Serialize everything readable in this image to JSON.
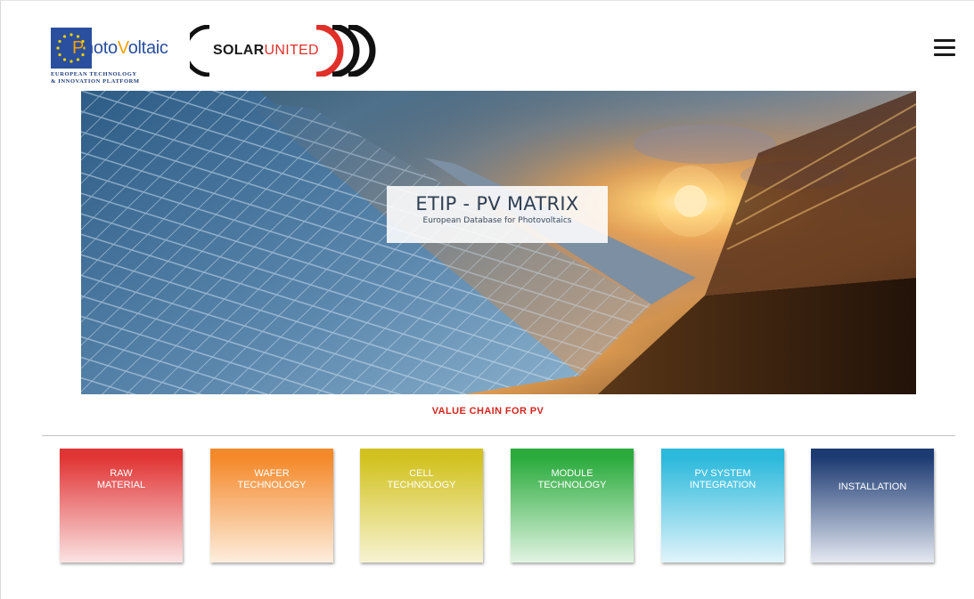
{
  "header": {
    "logo_pv": {
      "word_part1": "P",
      "word_part2": "hoto",
      "word_part3": "V",
      "word_part4": "oltaic",
      "line1": "EUROPEAN TECHNOLOGY",
      "line2": "& INNOVATION PLATFORM"
    },
    "logo_su": {
      "part1": "SOLAR",
      "part2": "UNITED"
    },
    "menu_icon": "hamburger-menu-icon"
  },
  "hero": {
    "title": "ETIP - PV MATRIX",
    "subtitle": "European Database for Photovoltaics"
  },
  "value_chain": {
    "title": "VALUE CHAIN FOR PV",
    "items": [
      {
        "label": "RAW\nMATERIAL",
        "color_top": "#e13535",
        "color_bottom": "#fbe3e3"
      },
      {
        "label": "WAFER\nTECHNOLOGY",
        "color_top": "#f4892a",
        "color_bottom": "#fdeede"
      },
      {
        "label": "CELL\nTECHNOLOGY",
        "color_top": "#d2c21f",
        "color_bottom": "#f7f3d2"
      },
      {
        "label": "MODULE\nTECHNOLOGY",
        "color_top": "#2aab3c",
        "color_bottom": "#e2f4e3"
      },
      {
        "label": "PV SYSTEM\nINTEGRATION",
        "color_top": "#2bb9dc",
        "color_bottom": "#e1f4fa"
      },
      {
        "label": "INSTALLATION",
        "color_top": "#1d3b73",
        "color_bottom": "#e4e8f1"
      }
    ]
  },
  "colors": {
    "accent_red": "#d3261f",
    "brand_blue": "#2a4f9e"
  }
}
